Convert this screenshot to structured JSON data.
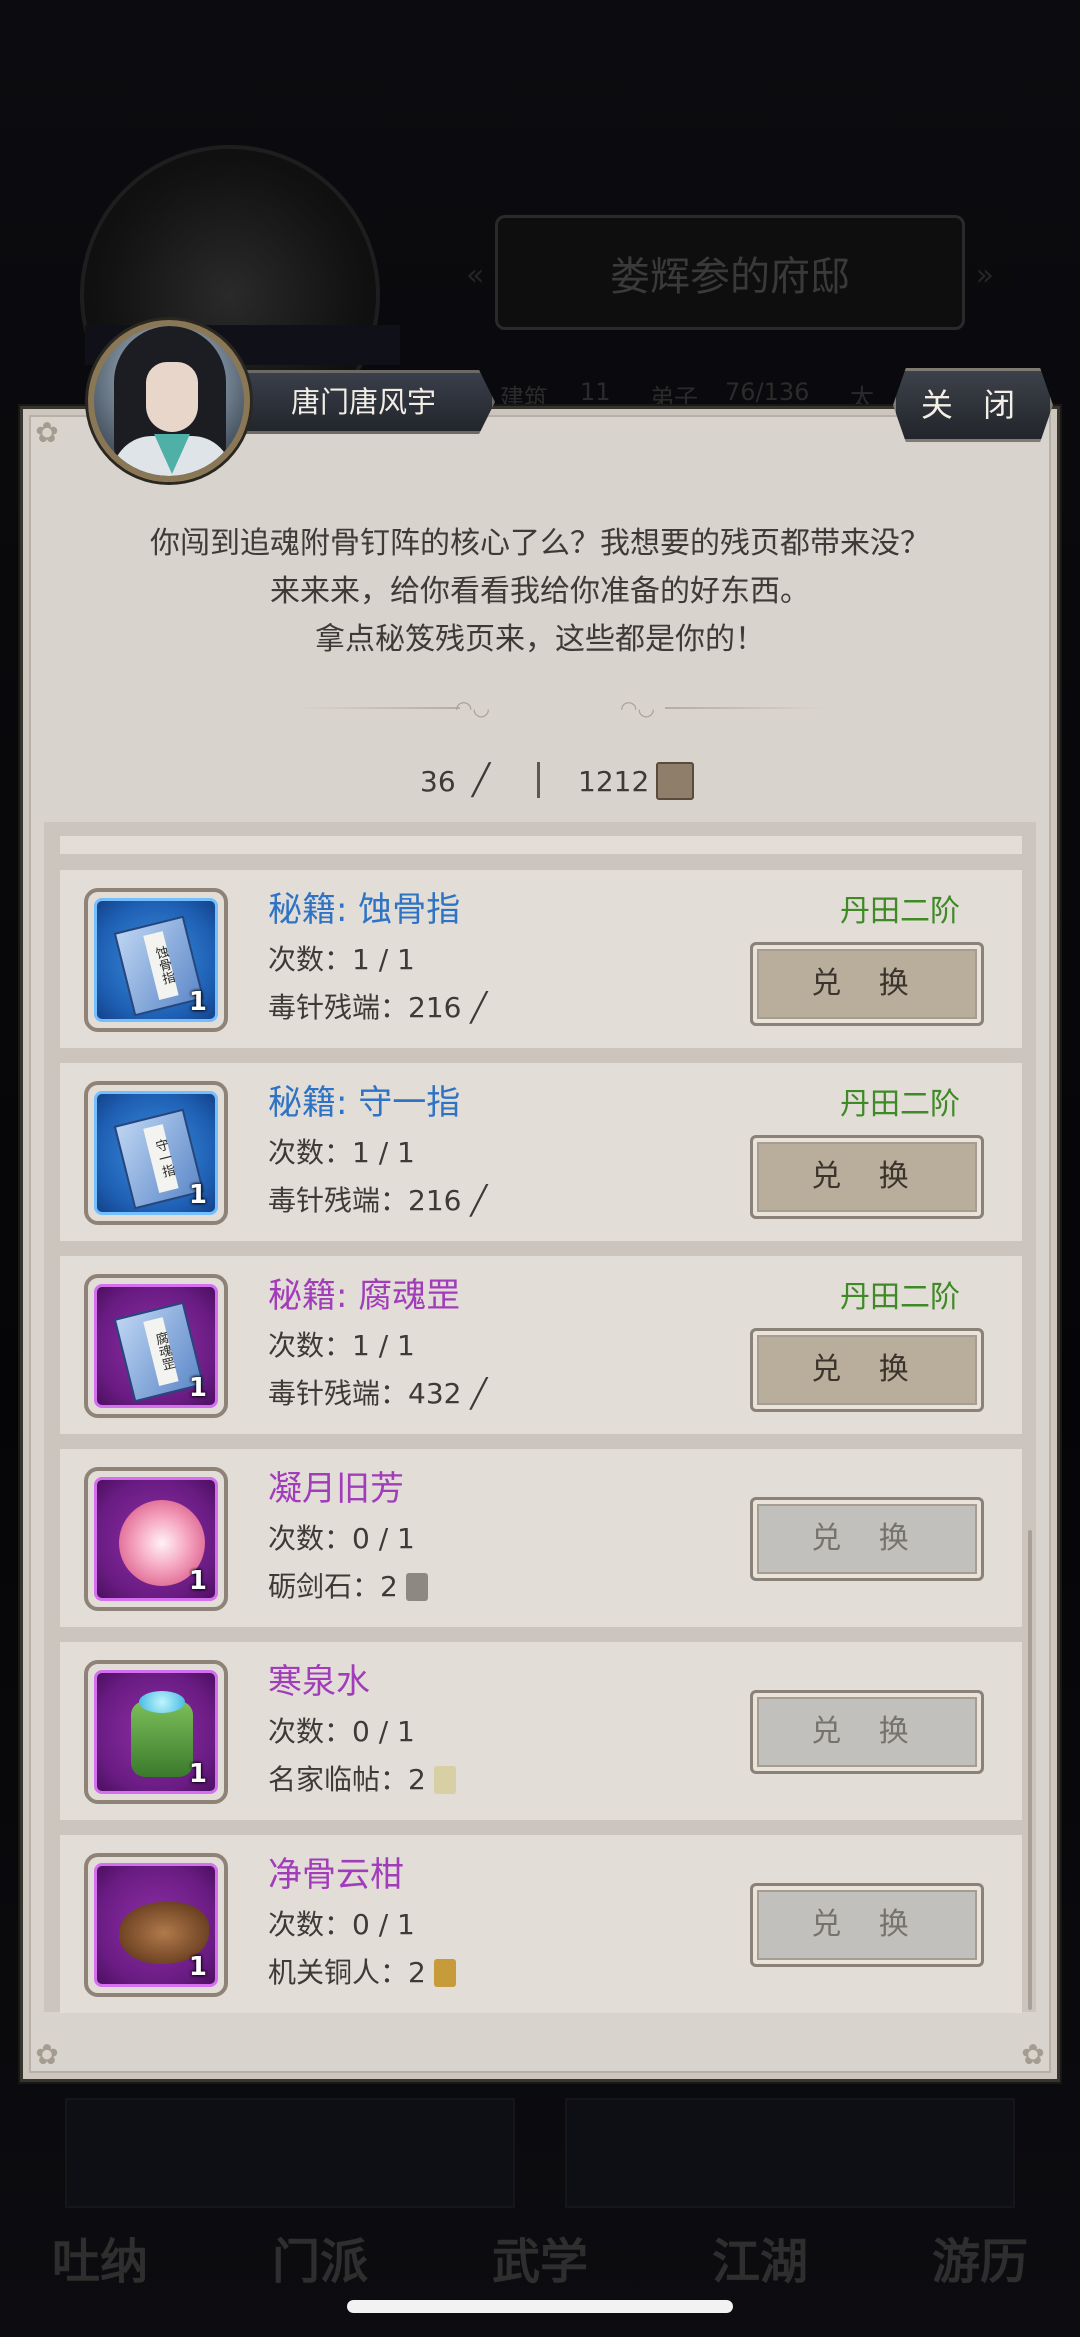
{
  "background": {
    "residence_title": "娄辉参的府邸",
    "stats": [
      "建筑",
      "11",
      "弟子",
      "76/136",
      "太"
    ],
    "nav": [
      "吐纳",
      "门派",
      "武学",
      "江湖",
      "游历"
    ]
  },
  "npc": {
    "name": "唐门唐风宇"
  },
  "close_label": "关 闭",
  "dialog": [
    "你闯到追魂附骨钉阵的核心了么？我想要的残页都带来没？",
    "来来来，给你看看我给你准备的好东西。",
    "拿点秘笈残页来，这些都是你的！"
  ],
  "currencies": {
    "poison_needle": "36",
    "secret_page": "1212",
    "poison_needle_icon": "needle-icon",
    "secret_page_icon": "scroll-fragment-icon"
  },
  "items": [
    {
      "title": "秘籍: 蚀骨指",
      "count": "次数：1 / 1",
      "cost": "毒针残端：216",
      "requirement": "丹田二阶",
      "button": "兑 换",
      "enabled": true,
      "rarity": "blue",
      "icon": "book-icon",
      "book_label": "蚀骨指",
      "qty": "1"
    },
    {
      "title": "秘籍: 守一指",
      "count": "次数：1 / 1",
      "cost": "毒针残端：216",
      "requirement": "丹田二阶",
      "button": "兑 换",
      "enabled": true,
      "rarity": "blue",
      "icon": "book-icon",
      "book_label": "守一指",
      "qty": "1"
    },
    {
      "title": "秘籍: 腐魂罡",
      "count": "次数：1 / 1",
      "cost": "毒针残端：432",
      "requirement": "丹田二阶",
      "button": "兑 换",
      "enabled": true,
      "rarity": "purple",
      "icon": "book-icon",
      "book_label": "腐魂罡",
      "qty": "1"
    },
    {
      "title": "凝月旧芳",
      "count": "次数：0 / 1",
      "cost": "砺剑石：2",
      "requirement": "",
      "button": "兑 换",
      "enabled": false,
      "rarity": "purple",
      "icon": "flower-icon",
      "qty": "1"
    },
    {
      "title": "寒泉水",
      "count": "次数：0 / 1",
      "cost": "名家临帖：2",
      "requirement": "",
      "button": "兑 换",
      "enabled": false,
      "rarity": "purple",
      "icon": "flask-icon",
      "qty": "1"
    },
    {
      "title": "净骨云柑",
      "count": "次数：0 / 1",
      "cost": "机关铜人：2",
      "requirement": "",
      "button": "兑 换",
      "enabled": false,
      "rarity": "purple",
      "icon": "herb-icon",
      "qty": "1"
    }
  ],
  "colors": {
    "blue_title": "#2f73c4",
    "purple_title": "#a13dbb",
    "requirement_green": "#3f8a27"
  }
}
